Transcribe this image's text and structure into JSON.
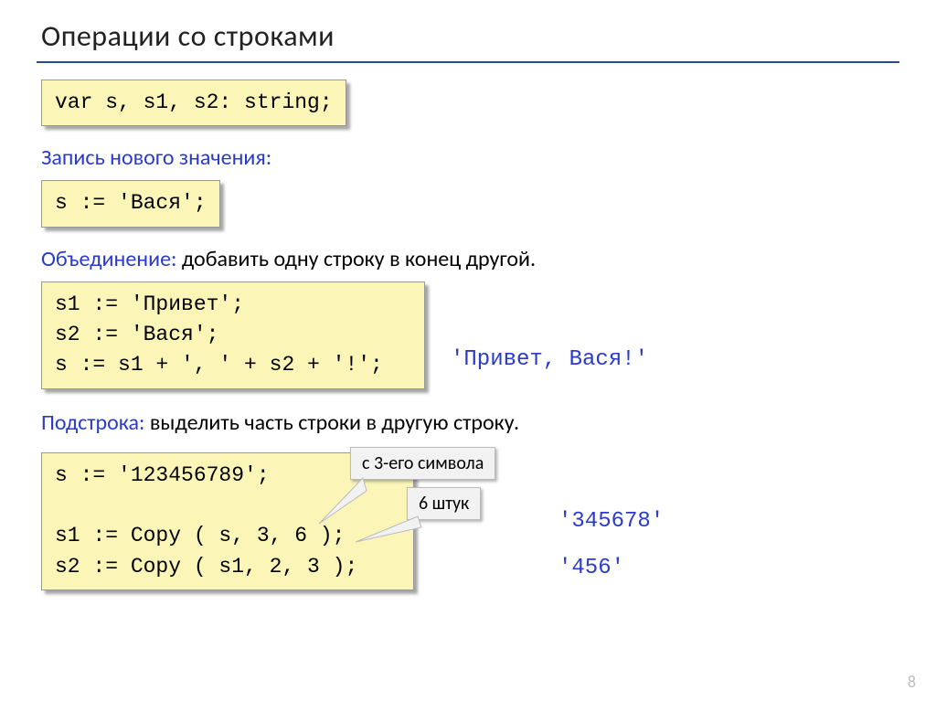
{
  "title": "Операции со строками",
  "code1": "var s, s1, s2: string;",
  "label_assign": "Запись нового значения:",
  "code2": "s := 'Вася';",
  "label_concat_blue": "Объединение:",
  "label_concat_rest": " добавить одну строку в конец другой.",
  "code3": "s1 := 'Привет';\ns2 := 'Вася';\ns := s1 + ', ' + s2 + '!';",
  "result_concat": "'Привет, Вася!'",
  "label_sub_blue": "Подстрока:",
  "label_sub_rest": " выделить часть строки в другую строку.",
  "code4": "s := '123456789';\n\ns1 := Copy ( s, 3, 6 );\ns2 := Copy ( s1, 2, 3 );",
  "callout1": "с 3-его символа",
  "callout2": "6 штук",
  "result_copy1": "'345678'",
  "result_copy2": "'456'",
  "page": "8"
}
